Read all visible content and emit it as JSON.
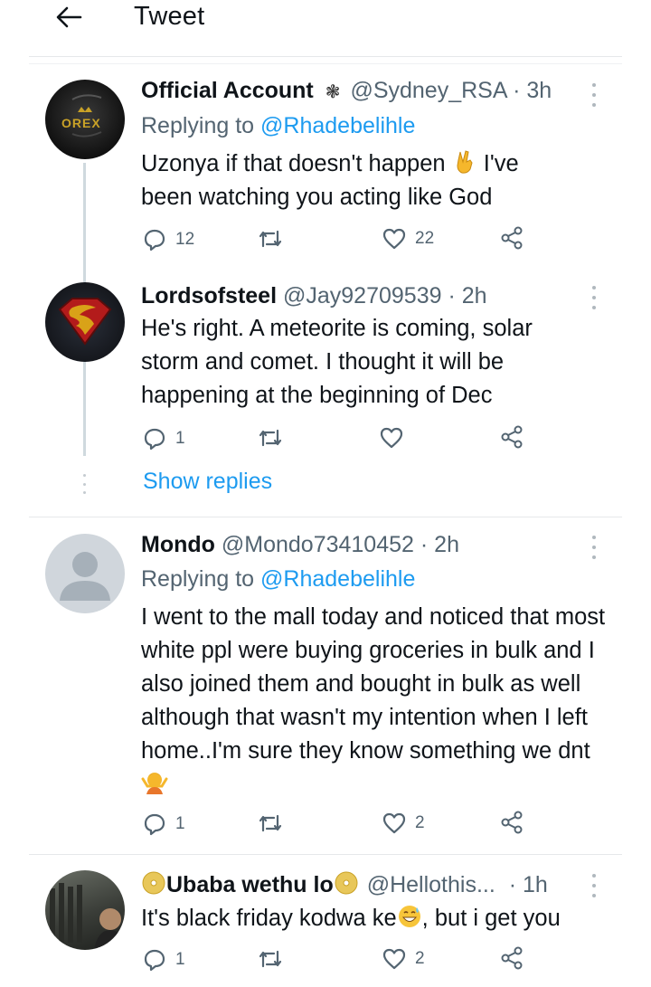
{
  "header": {
    "title": "Tweet",
    "back_icon": "arrow-left-icon"
  },
  "tweets": [
    {
      "name": "Official Account",
      "badge_icon": "flower-icon",
      "handle": "@Sydney_RSA",
      "time": "· 3h",
      "replying_prefix": "Replying to",
      "replying_to": "@Rhadebelihle",
      "avatar_text": "OREX",
      "text_1": "Uzonya if that doesn't happen",
      "text_emoji": "victory-hand-emoji",
      "text_2": "I've",
      "text_3": "been watching you acting like God",
      "replies": "12",
      "retweets": "",
      "likes": "22"
    },
    {
      "name": "Lordsofsteel",
      "handle": "@Jay92709539",
      "time": "· 2h",
      "text": "He's right. A meteorite is coming, solar storm and comet. I thought it will be happening at the beginning of Dec",
      "replies": "1",
      "retweets": "",
      "likes": ""
    },
    {
      "name": "Mondo",
      "handle": "@Mondo73410452",
      "time": "· 2h",
      "replying_prefix": "Replying to",
      "replying_to": "@Rhadebelihle",
      "text": "I went to the mall today and noticed that most white ppl were buying groceries in bulk and I also joined them and bought in bulk as well although that wasn't my intention when I left home..I'm sure they know something we dnt",
      "text_emoji": "person-shrugging-emoji",
      "replies": "1",
      "retweets": "",
      "likes": "2"
    },
    {
      "name": "Ubaba wethu lo",
      "name_emoji": "cd-emoji",
      "handle": "@Hellothis...",
      "time": "· 1h",
      "text_1": "It's black friday kodwa ke",
      "text_emoji": "grinning-sweat-emoji",
      "text_2": ", but i get you",
      "replies": "1",
      "retweets": "",
      "likes": "2"
    }
  ],
  "show_replies": "Show replies",
  "colors": {
    "link": "#1d9bf0",
    "muted": "#536471",
    "text": "#0f1419",
    "thread": "#cfd9de"
  }
}
